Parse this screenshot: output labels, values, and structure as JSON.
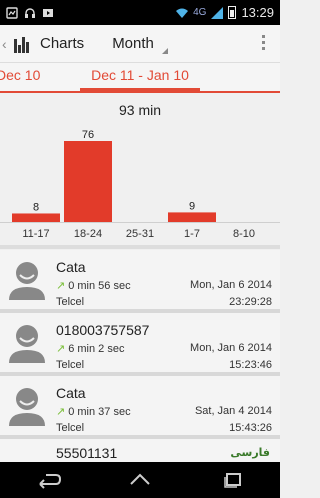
{
  "status_bar": {
    "network": "4G",
    "time": "13:29",
    "left_icons": [
      "notification-icon",
      "headphones-icon",
      "media-icon"
    ],
    "right_icons": [
      "wifi-icon",
      "signal-icon",
      "battery-icon"
    ]
  },
  "action_bar": {
    "title": "Charts",
    "period": "Month"
  },
  "tabs": {
    "previous": "Dec 10",
    "current": "Dec 11 - Jan 10"
  },
  "chart_data": {
    "type": "bar",
    "title": "93 min",
    "categories": [
      "11-17",
      "18-24",
      "25-31",
      "1-7",
      "8-10"
    ],
    "values": [
      8,
      76,
      0,
      9,
      0
    ],
    "ylim": [
      0,
      76
    ],
    "data_labels": [
      "8",
      "76",
      "",
      "9",
      ""
    ],
    "xlabel": "",
    "ylabel": "",
    "grid": false,
    "colors": {
      "bar": "#e23b2a"
    }
  },
  "calls": [
    {
      "name": "Cata",
      "duration": "0 min 56 sec",
      "carrier": "Telcel",
      "date": "Mon, Jan 6 2014",
      "time": "23:29:28"
    },
    {
      "name": "018003757587",
      "duration": "6 min 2 sec",
      "carrier": "Telcel",
      "date": "Mon, Jan 6 2014",
      "time": "15:23:46"
    },
    {
      "name": "Cata",
      "duration": "0 min 37 sec",
      "carrier": "Telcel",
      "date": "Sat, Jan 4 2014",
      "time": "15:43:26"
    },
    {
      "name": "55501131",
      "duration": "",
      "carrier": "",
      "date": "",
      "time": ""
    }
  ],
  "watermark": "فارسی",
  "colors": {
    "accent": "#e24a36",
    "outgoing_arrow": "#7bbf3a"
  }
}
